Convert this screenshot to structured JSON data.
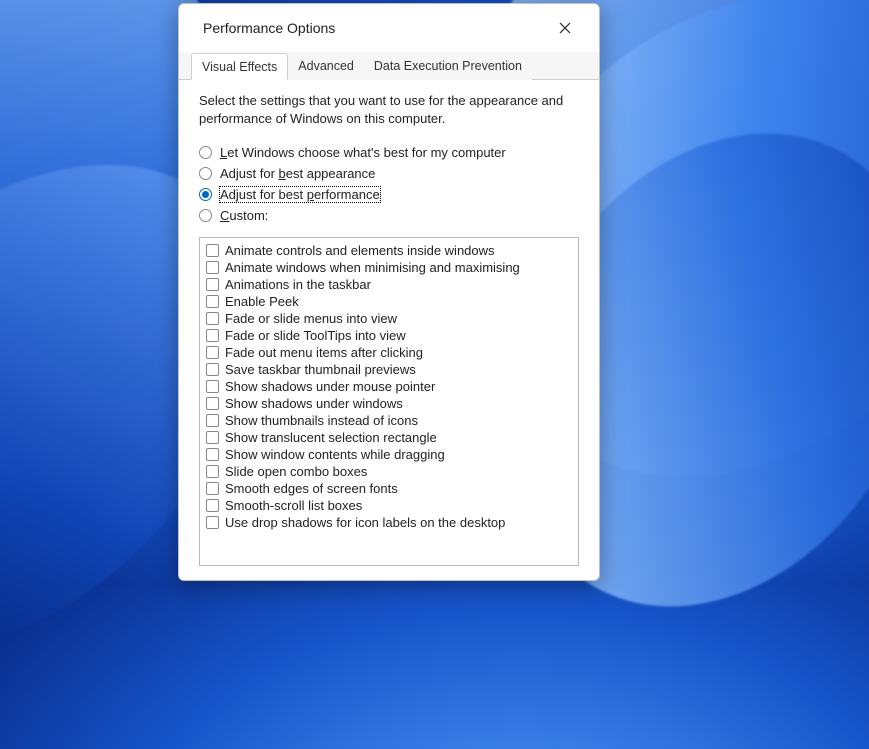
{
  "title": "Performance Options",
  "tabs": [
    {
      "label": "Visual Effects",
      "active": true
    },
    {
      "label": "Advanced",
      "active": false
    },
    {
      "label": "Data Execution Prevention",
      "active": false
    }
  ],
  "intro": "Select the settings that you want to use for the appearance and performance of Windows on this computer.",
  "radios": [
    {
      "label": "Let Windows choose what's best for my computer",
      "accel": "L",
      "selected": false
    },
    {
      "label": "Adjust for best appearance",
      "accel": "b",
      "selected": false
    },
    {
      "label": "Adjust for best performance",
      "accel": "p",
      "selected": true,
      "focused": true
    },
    {
      "label": "Custom:",
      "accel": "C",
      "selected": false
    }
  ],
  "effects": [
    {
      "label": "Animate controls and elements inside windows",
      "checked": false
    },
    {
      "label": "Animate windows when minimising and maximising",
      "checked": false
    },
    {
      "label": "Animations in the taskbar",
      "checked": false
    },
    {
      "label": "Enable Peek",
      "checked": false
    },
    {
      "label": "Fade or slide menus into view",
      "checked": false
    },
    {
      "label": "Fade or slide ToolTips into view",
      "checked": false
    },
    {
      "label": "Fade out menu items after clicking",
      "checked": false
    },
    {
      "label": "Save taskbar thumbnail previews",
      "checked": false
    },
    {
      "label": "Show shadows under mouse pointer",
      "checked": false
    },
    {
      "label": "Show shadows under windows",
      "checked": false
    },
    {
      "label": "Show thumbnails instead of icons",
      "checked": false
    },
    {
      "label": "Show translucent selection rectangle",
      "checked": false
    },
    {
      "label": "Show window contents while dragging",
      "checked": false
    },
    {
      "label": "Slide open combo boxes",
      "checked": false
    },
    {
      "label": "Smooth edges of screen fonts",
      "checked": false
    },
    {
      "label": "Smooth-scroll list boxes",
      "checked": false
    },
    {
      "label": "Use drop shadows for icon labels on the desktop",
      "checked": false
    }
  ]
}
